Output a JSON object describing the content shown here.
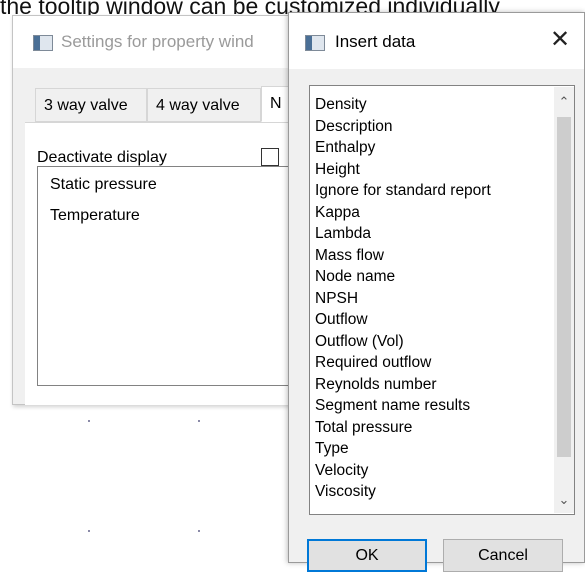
{
  "caption": "the tooltip window can be customized individually",
  "settings_window": {
    "title": "Settings for property wind",
    "tabs": [
      {
        "label": "3 way valve"
      },
      {
        "label": "4 way valve"
      },
      {
        "label": "N"
      }
    ],
    "deactivate_display_label": "Deactivate display",
    "deactivate_display_checked": false,
    "displayed_values": [
      "Static pressure",
      "Temperature"
    ]
  },
  "insert_dialog": {
    "title": "Insert data",
    "fields": [
      "Density",
      "Description",
      "Enthalpy",
      "Height",
      "Ignore for standard report",
      "Kappa",
      "Lambda",
      "Mass flow",
      "Node name",
      "NPSH",
      "Outflow",
      "Outflow (Vol)",
      "Required outflow",
      "Reynolds number",
      "Segment name results",
      "Total pressure",
      "Type",
      "Velocity",
      "Viscosity"
    ],
    "ok_label": "OK",
    "cancel_label": "Cancel"
  },
  "colors": {
    "dialog_background": "#f0f0f0",
    "default_button_border": "#0078d7",
    "disabled_title_text": "#9a9a9a"
  },
  "icons": {
    "window_icon": "app-window-icon",
    "close": "close-icon",
    "scroll_up": "chevron-up-icon",
    "scroll_down": "chevron-down-icon"
  }
}
